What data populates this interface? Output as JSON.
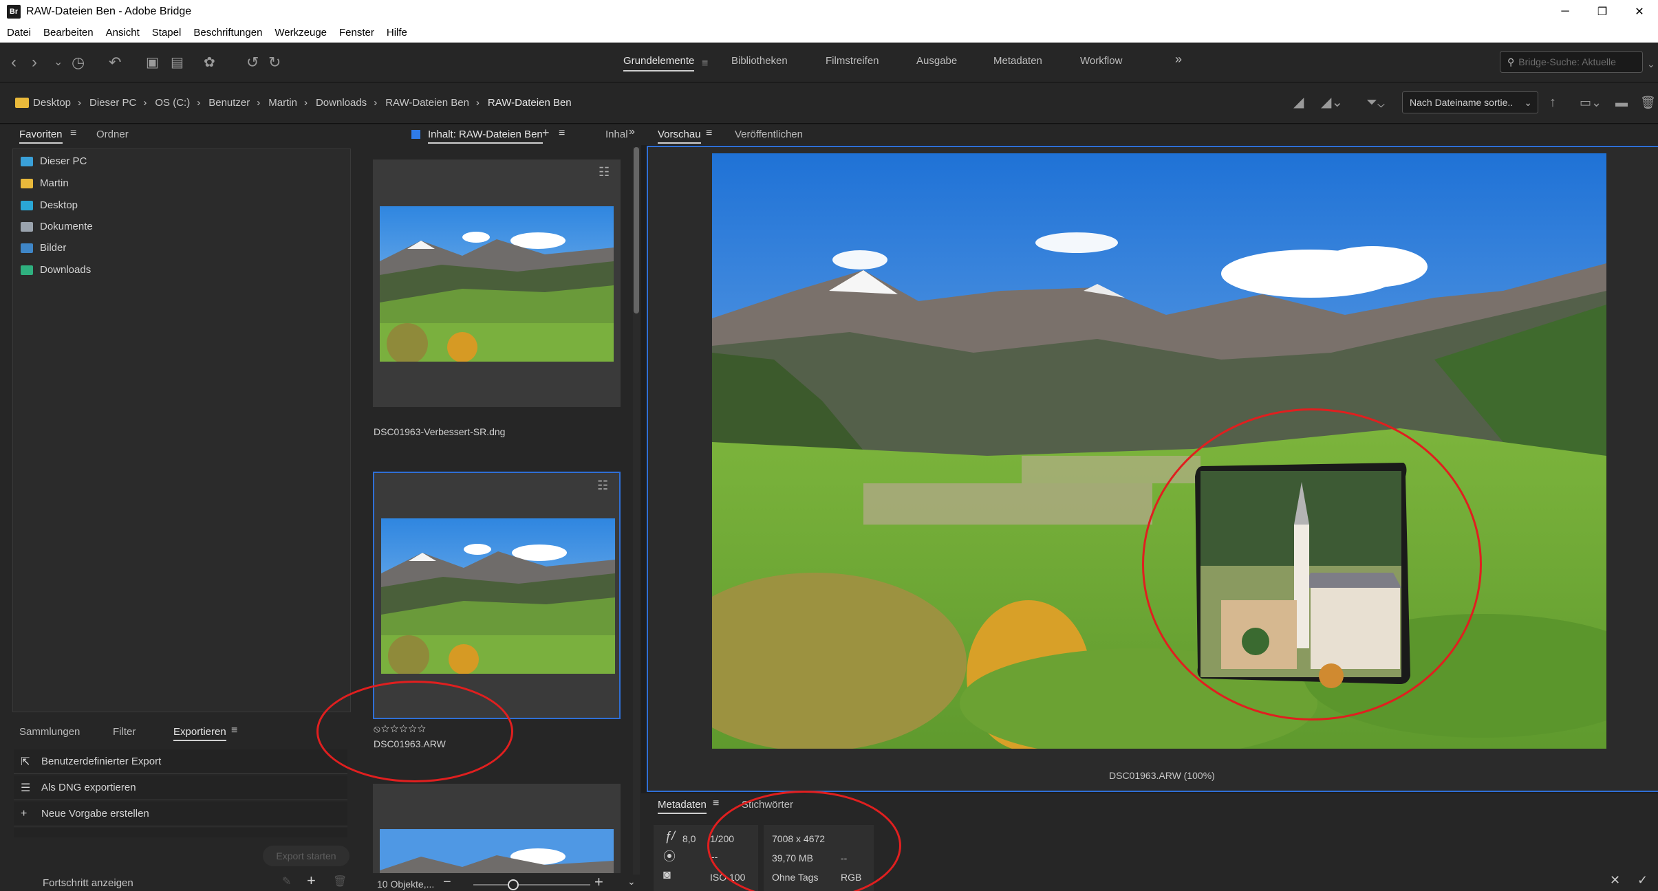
{
  "window": {
    "title": "RAW-Dateien Ben - Adobe Bridge",
    "logo": "Br",
    "minimize": "─",
    "maximize": "❐",
    "close": "✕"
  },
  "menu": [
    "Datei",
    "Bearbeiten",
    "Ansicht",
    "Stapel",
    "Beschriftungen",
    "Werkzeuge",
    "Fenster",
    "Hilfe"
  ],
  "workspaces": {
    "items": [
      "Grundelemente",
      "Bibliotheken",
      "Filmstreifen",
      "Ausgabe",
      "Metadaten",
      "Workflow"
    ],
    "active": "Grundelemente",
    "more": "»"
  },
  "search": {
    "placeholder": "Bridge-Suche: Aktuelle"
  },
  "breadcrumb": [
    "Desktop",
    "Dieser PC",
    "OS (C:)",
    "Benutzer",
    "Martin",
    "Downloads",
    "RAW-Dateien Ben",
    "RAW-Dateien Ben"
  ],
  "sort": {
    "label": "Nach Dateiname sortie.."
  },
  "left_panel": {
    "tabs": [
      "Favoriten",
      "Ordner"
    ],
    "favorites": [
      {
        "label": "Dieser PC",
        "color": "#3aa0d8"
      },
      {
        "label": "Martin",
        "color": "#e9b93b"
      },
      {
        "label": "Desktop",
        "color": "#2aa7d6"
      },
      {
        "label": "Dokumente",
        "color": "#9aa3ad"
      },
      {
        "label": "Bilder",
        "color": "#3f86c7"
      },
      {
        "label": "Downloads",
        "color": "#2fb07f"
      }
    ]
  },
  "export_panel": {
    "tabs": [
      "Sammlungen",
      "Filter",
      "Exportieren"
    ],
    "items": [
      "Benutzerdefinierter Export",
      "Als DNG exportieren",
      "Neue Vorgabe erstellen"
    ],
    "start_button": "Export starten",
    "progress_label": "Fortschritt anzeigen"
  },
  "content": {
    "tab": "Inhalt: RAW-Dateien Ben",
    "tab_partial": "Inhal",
    "files": [
      {
        "name": "DSC01963-Verbessert-SR.dng"
      },
      {
        "name": "DSC01963.ARW",
        "rating": "⦸☆☆☆☆☆"
      }
    ],
    "count": "10 Objekte,..."
  },
  "preview": {
    "tabs": [
      "Vorschau",
      "Veröffentlichen"
    ],
    "caption": "DSC01963.ARW (100%)"
  },
  "metadata": {
    "tabs": [
      "Metadaten",
      "Stichwörter"
    ],
    "aperture": "8,0",
    "shutter": "1/200",
    "dimensions": "7008 x 4672",
    "size": "39,70 MB",
    "dash": "--",
    "iso": "ISO 100",
    "tags": "Ohne Tags",
    "mode": "RGB"
  }
}
